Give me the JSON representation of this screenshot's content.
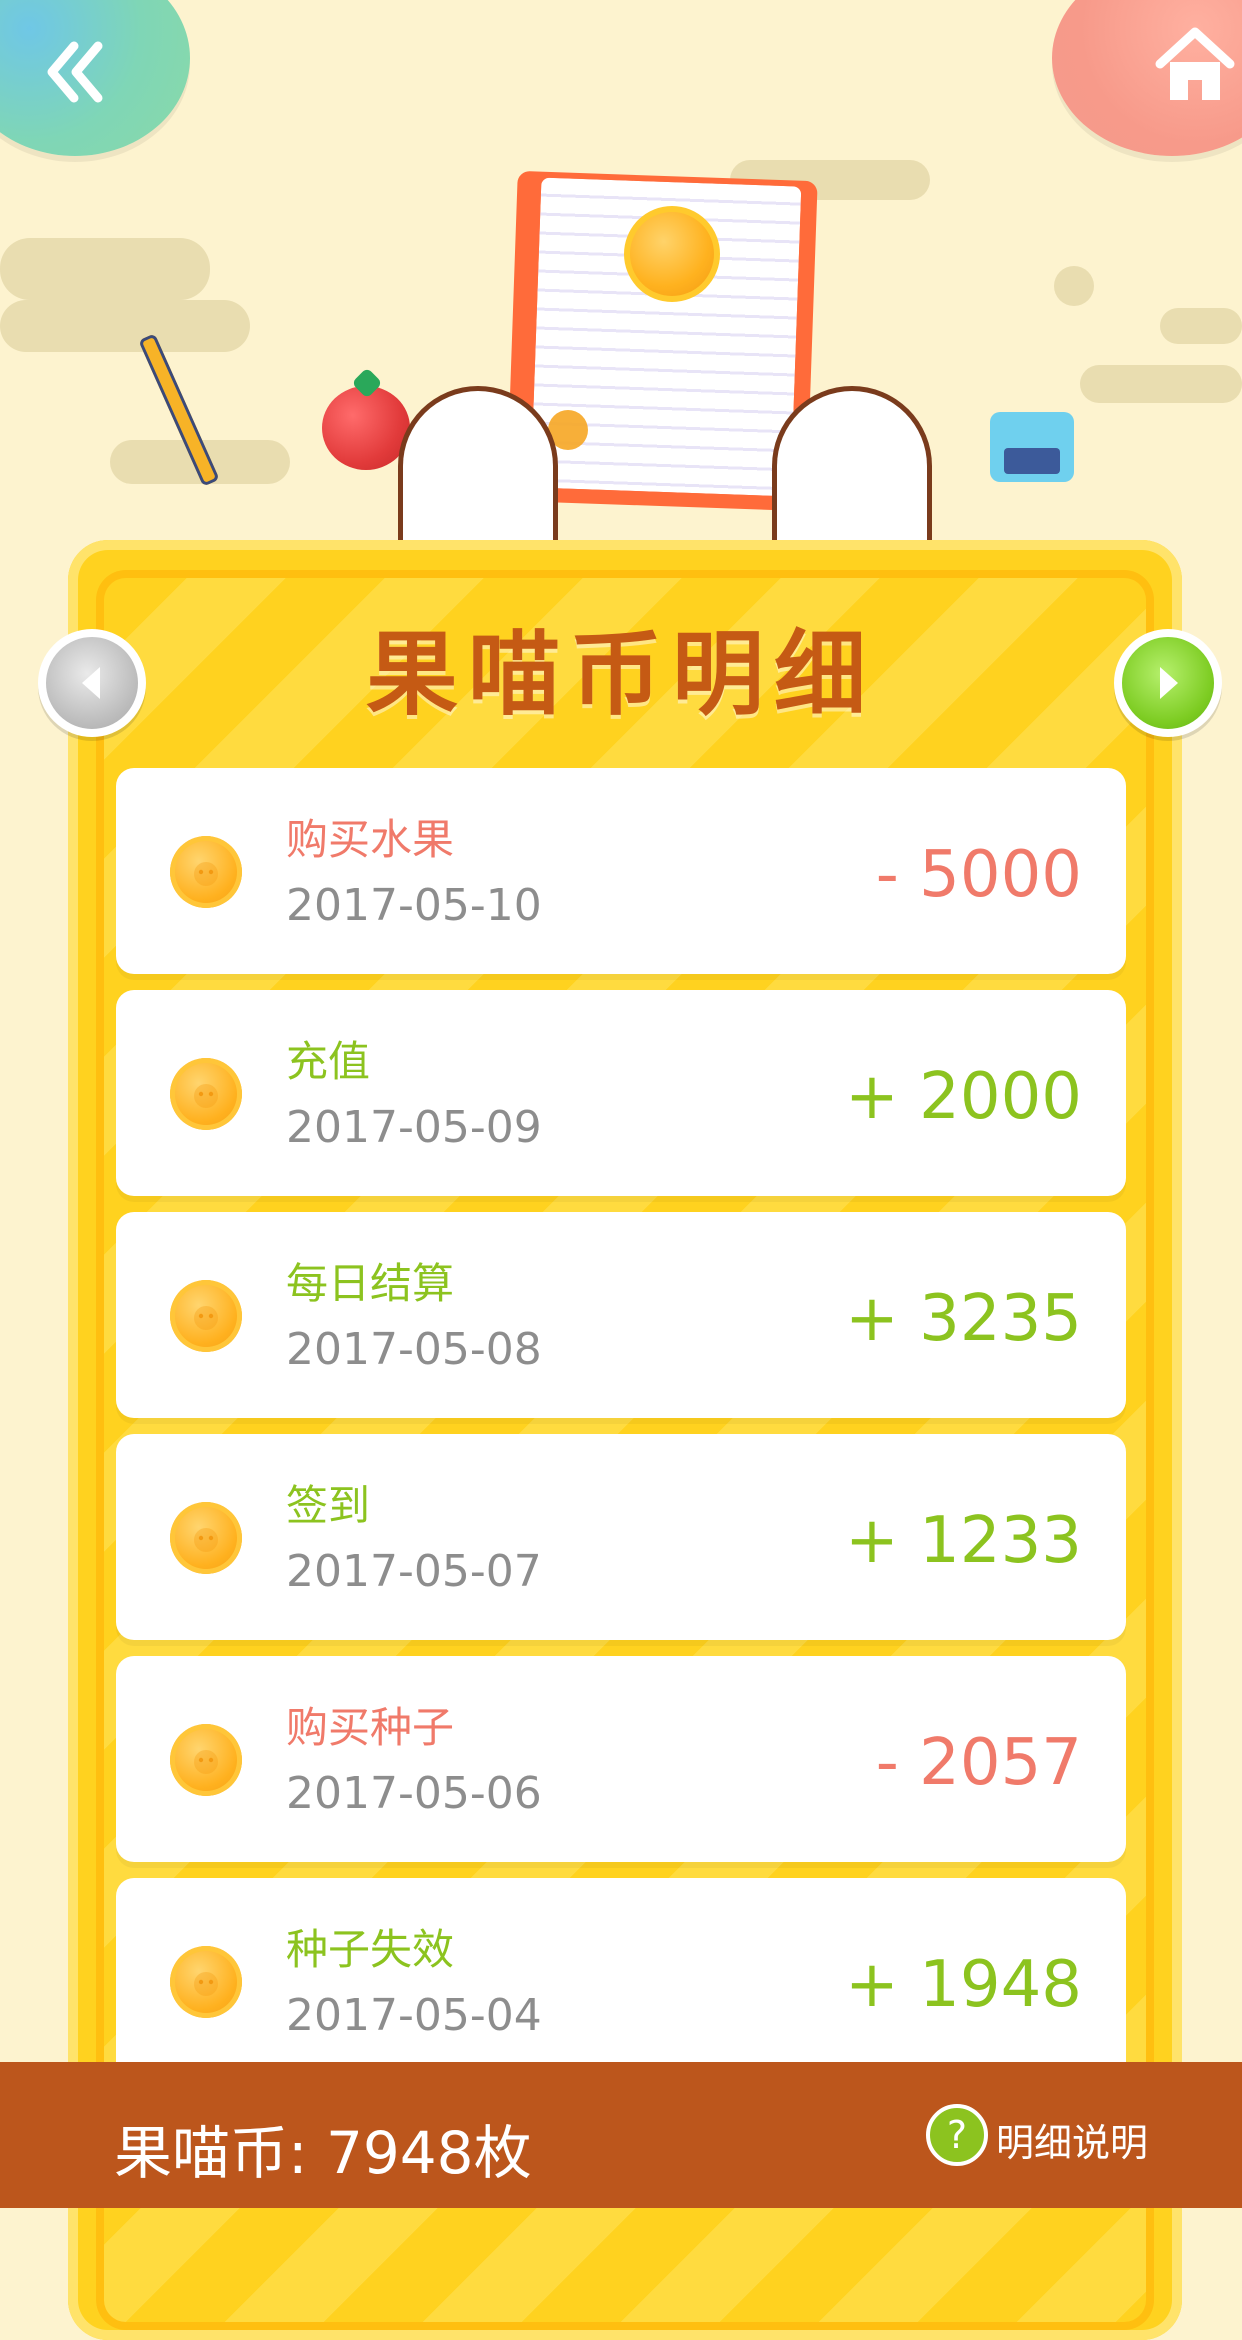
{
  "header": {
    "title": "果喵币明细",
    "back_icon": "double-chevron-left-icon",
    "home_icon": "home-icon",
    "prev_icon": "chevron-left-icon",
    "next_icon": "chevron-right-icon"
  },
  "transactions": [
    {
      "title": "购买水果",
      "date": "2017-05-10",
      "amount": "- 5000",
      "type": "expense"
    },
    {
      "title": "充值",
      "date": "2017-05-09",
      "amount": "+ 2000",
      "type": "income"
    },
    {
      "title": "每日结算",
      "date": "2017-05-08",
      "amount": "+ 3235",
      "type": "income"
    },
    {
      "title": "签到",
      "date": "2017-05-07",
      "amount": "+ 1233",
      "type": "income"
    },
    {
      "title": "购买种子",
      "date": "2017-05-06",
      "amount": "- 2057",
      "type": "expense"
    },
    {
      "title": "种子失效",
      "date": "2017-05-04",
      "amount": "+ 1948",
      "type": "income"
    }
  ],
  "footer": {
    "balance_text": "果喵币: 7948枚",
    "help_label": "明细说明",
    "help_icon": "question-mark-icon"
  },
  "colors": {
    "background": "#fdf3cf",
    "board": "#ffd21f",
    "title": "#c55a14",
    "expense": "#f07a6a",
    "income": "#8cc31f",
    "footer": "#bc561c"
  }
}
